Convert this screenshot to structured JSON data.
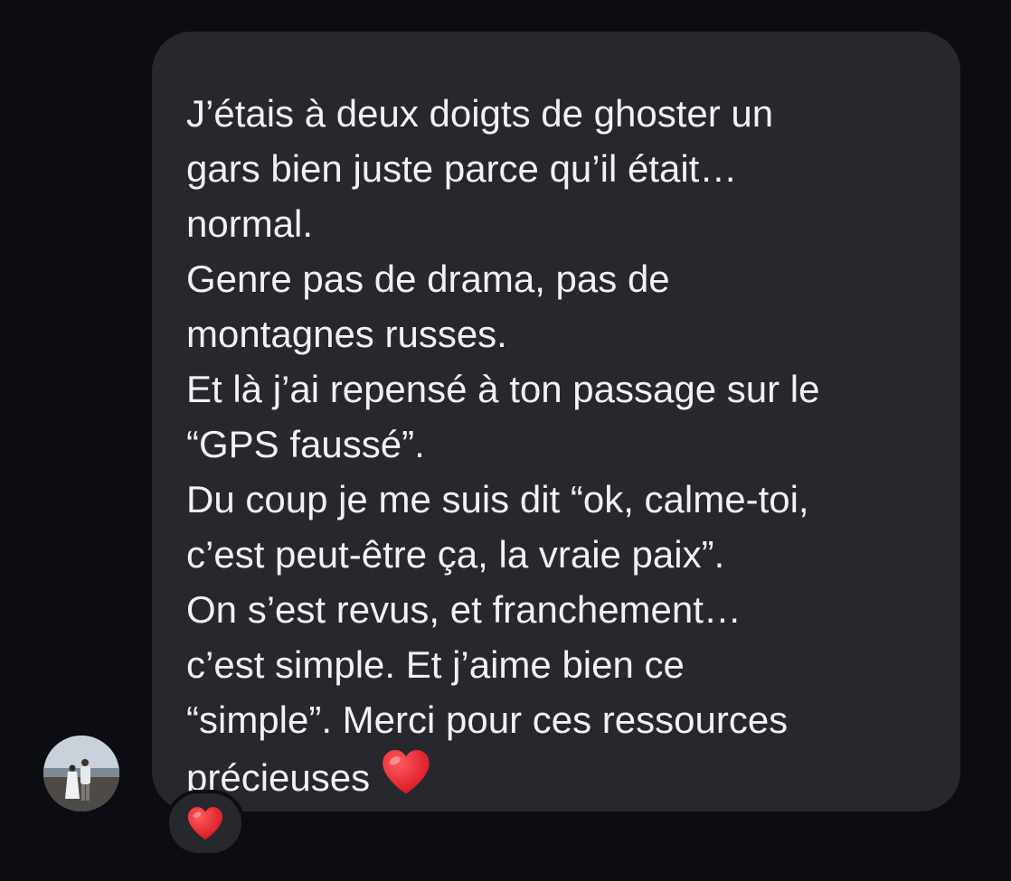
{
  "conversation": {
    "message": {
      "lines": [
        "J’étais à deux doigts de ghoster un",
        "gars bien juste parce qu’il était…",
        "normal.",
        "Genre pas de drama, pas de",
        "montagnes russes.",
        "Et là j’ai repensé à ton passage sur le",
        "“GPS faussé”.",
        "Du coup je me suis dit “ok, calme-toi,",
        "c’est peut-être ça, la vraie paix”.",
        "On s’est revus, et franchement…",
        "c’est simple. Et j’aime bien ce",
        "“simple”. Merci pour ces ressources",
        "précieuses"
      ],
      "inline_icon": "red-heart-emoji",
      "reaction": "red-heart-emoji"
    }
  },
  "colors": {
    "background": "#0b0d12",
    "bubble": "#26282d",
    "text": "#f2f2f4",
    "heart": "#e8242f"
  }
}
